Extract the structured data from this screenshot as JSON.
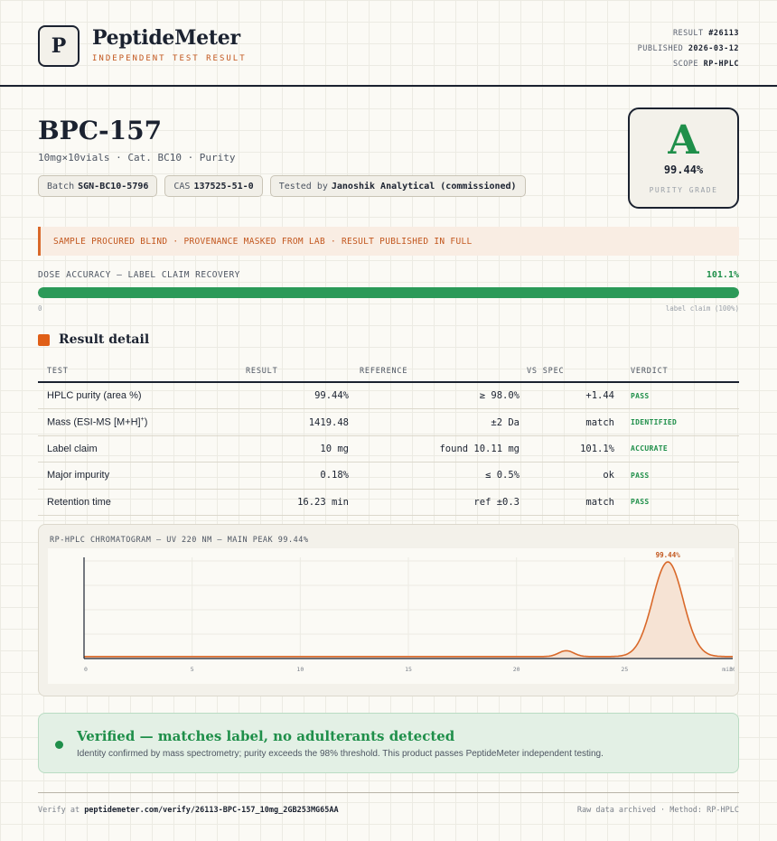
{
  "brand": {
    "logo_letter": "P",
    "name": "PeptideMeter",
    "tagline": "INDEPENDENT TEST RESULT"
  },
  "meta": {
    "result_label": "RESULT",
    "result_value": "#26113",
    "published_label": "PUBLISHED",
    "published_value": "2026-03-12",
    "scope_label": "SCOPE",
    "scope_value": "RP-HPLC"
  },
  "product": {
    "title": "BPC-157",
    "subtitle": "10mg×10vials · Cat. BC10 · Purity",
    "chips": [
      {
        "label": "Batch",
        "value": "SGN-BC10-5796"
      },
      {
        "label": "CAS",
        "value": "137525-51-0"
      },
      {
        "label": "Tested by",
        "value": "Janoshik Analytical (commissioned)"
      }
    ]
  },
  "grade": {
    "letter": "A",
    "value": "99.44%",
    "caption": "PURITY GRADE",
    "color": "#1f8f4a"
  },
  "banner": "SAMPLE PROCURED BLIND · PROVENANCE MASKED FROM LAB · RESULT PUBLISHED IN FULL",
  "dose": {
    "label": "DOSE ACCURACY — LABEL CLAIM RECOVERY",
    "value": "101.1%",
    "fill_fraction": 1.0,
    "min_label": "0",
    "max_label": "label claim (100%)"
  },
  "section_title": "Result detail",
  "table": {
    "headers": [
      "TEST",
      "RESULT",
      "REFERENCE",
      "VS SPEC",
      "VERDICT"
    ],
    "rows": [
      {
        "test": "HPLC purity (area %)",
        "result": "99.44%",
        "reference": "≥ 98.0%",
        "vs_spec": "+1.44",
        "verdict": "PASS"
      },
      {
        "test": "Mass (ESI-MS [M+H]",
        "test_sup": "+",
        "test_end": ")",
        "result": "1419.48",
        "reference": "±2 Da",
        "vs_spec": "match",
        "verdict": "IDENTIFIED"
      },
      {
        "test": "Label claim",
        "result": "10 mg",
        "reference": "found 10.11 mg",
        "vs_spec": "101.1%",
        "verdict": "ACCURATE"
      },
      {
        "test": "Major impurity",
        "result": "0.18%",
        "reference": "≤ 0.5%",
        "vs_spec": "ok",
        "verdict": "PASS"
      },
      {
        "test": "Retention time",
        "result": "16.23 min",
        "reference": "ref ±0.3",
        "vs_spec": "match",
        "verdict": "PASS"
      }
    ]
  },
  "chromatogram": {
    "title": "RP-HPLC CHROMATOGRAM — UV 220 NM — MAIN PEAK 99.44%",
    "peak_label": "99.44%",
    "x_ticks": [
      "0",
      "5",
      "10",
      "15",
      "20",
      "25",
      "30"
    ],
    "x_unit": "min",
    "line_color": "#d9692a",
    "chart_data": {
      "type": "line",
      "x_range": [
        0,
        30
      ],
      "baseline": 0.02,
      "peaks": [
        {
          "rt": 22.3,
          "height": 0.06,
          "width": 0.35
        },
        {
          "rt": 27.0,
          "height": 0.97,
          "width": 0.7,
          "label": "99.44%"
        }
      ]
    }
  },
  "verified": {
    "title": "Verified — matches label, no adulterants detected",
    "subtitle": "Identity confirmed by mass spectrometry; purity exceeds the 98% threshold. This product passes PeptideMeter independent testing."
  },
  "footer": {
    "verify_prefix": "Verify at",
    "verify_url": "peptidemeter.com/verify/26113-BPC-157_10mg_2GB253MG65AA",
    "right": "Raw data archived · Method: RP-HPLC"
  }
}
